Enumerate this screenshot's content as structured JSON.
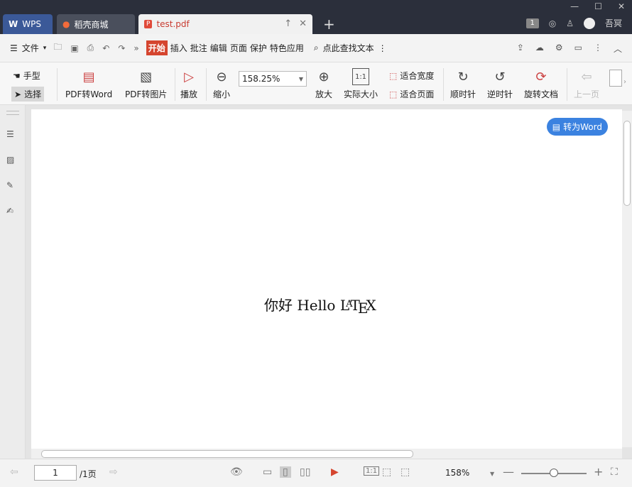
{
  "tabs": {
    "wps": "WPS",
    "shop": "稻壳商城",
    "pdf": "test.pdf"
  },
  "titlebar": {
    "badge": "1",
    "username": "吾冥"
  },
  "menu": {
    "file": "文件",
    "items": [
      "开始",
      "插入",
      "批注",
      "编辑",
      "页面",
      "保护",
      "特色应用"
    ],
    "search": "点此查找文本"
  },
  "toolbar": {
    "hand": "手型",
    "select": "选择",
    "pdf_to_word": "PDF转Word",
    "pdf_to_image": "PDF转图片",
    "play": "播放",
    "zoom_out": "缩小",
    "zoom_value": "158.25%",
    "zoom_in": "放大",
    "actual_size": "实际大小",
    "fit_width": "适合宽度",
    "fit_page": "适合页面",
    "clockwise": "顺时针",
    "counterclockwise": "逆时针",
    "rotate_doc": "旋转文档",
    "prev_page": "上一页"
  },
  "document": {
    "text_cn": "你好",
    "text_en": "Hello",
    "convert_button": "转为Word"
  },
  "status": {
    "page_current": "1",
    "page_total": "/1页",
    "zoom": "158%"
  },
  "colors": {
    "accent": "#d5452f",
    "convert_blue": "#3b82e0",
    "titlebar": "#2b2f3b"
  }
}
